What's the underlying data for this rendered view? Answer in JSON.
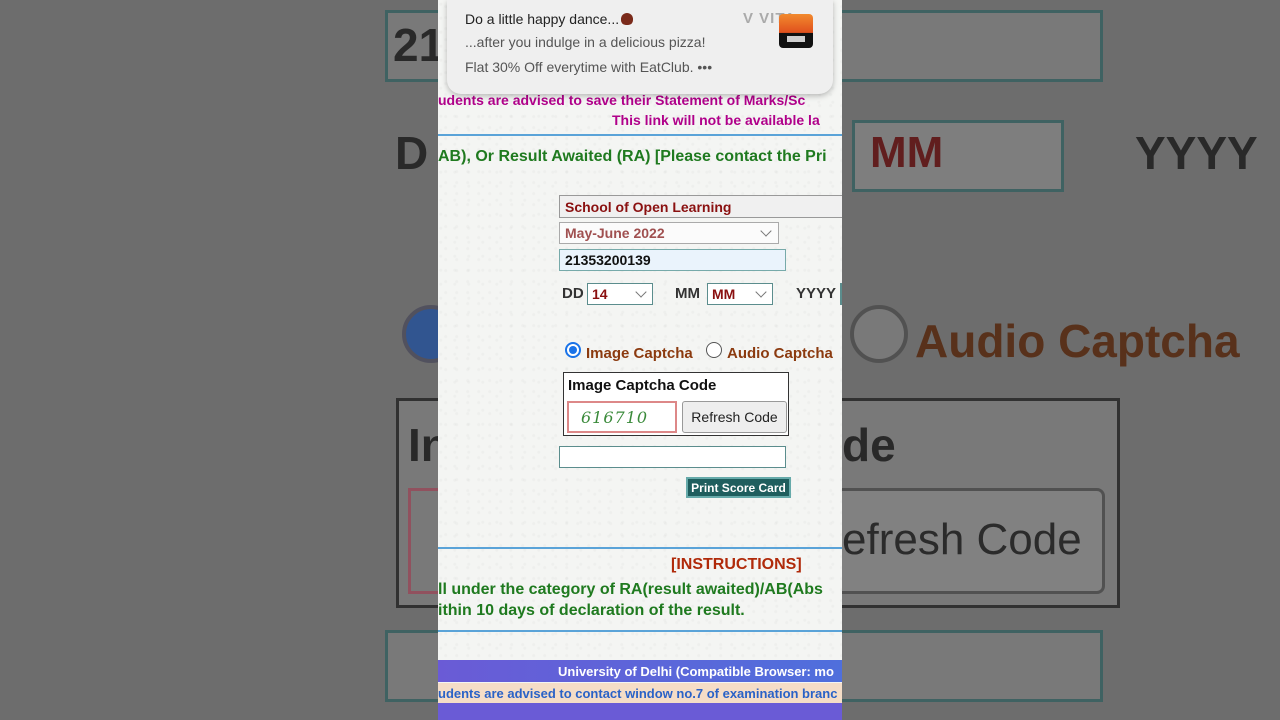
{
  "background": {
    "roll_fragment": "21",
    "dob_fragment": "D",
    "mm_fragment": "MM",
    "yyyy_fragment": "YYYY",
    "audio_captcha": "Audio Captcha",
    "image_captcha_fragment": "In",
    "code_fragment": "de",
    "refresh_fragment": "efresh Code"
  },
  "notification": {
    "title": "Do a little happy dance...",
    "line2": "...after you indulge in a delicious pizza!",
    "line3": "Flat 30% Off everytime with EatClub. •••",
    "brand": "V VITA"
  },
  "page": {
    "notice_line1": "udents are advised to save their Statement of Marks/Sc",
    "notice_line2": "This link will not be available la",
    "status_line": "AB), Or Result Awaited (RA) [Please contact the Pri",
    "school": "School of Open Learning",
    "session": "May-June 2022",
    "roll_number": "21353200139",
    "dob": {
      "dd_label": "DD",
      "dd_value": "14",
      "mm_label": "MM",
      "mm_value": "MM",
      "yyyy_label": "YYYY"
    },
    "captcha": {
      "image_option": "Image Captcha",
      "audio_option": "Audio Captcha",
      "selected": "image",
      "box_title": "Image Captcha Code",
      "code": "616710",
      "refresh_label": "Refresh Code"
    },
    "print_label": "Print Score Card",
    "instructions_title": "[INSTRUCTIONS]",
    "instr_line1": "ll under the category of RA(result awaited)/AB(Abs",
    "instr_line2": "ithin 10 days of declaration of the result.",
    "footer_bar": "University of Delhi (Compatible Browser: mo",
    "footer_note": "udents are advised to contact window no.7 of examination branc"
  }
}
